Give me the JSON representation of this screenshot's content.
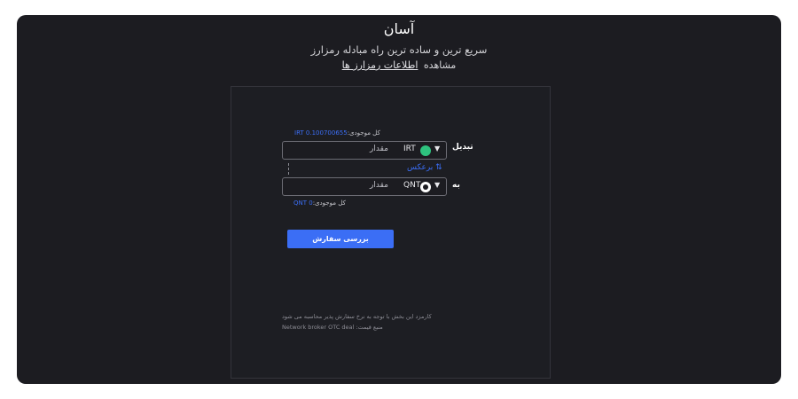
{
  "header": {
    "title": "آسان",
    "subtitle": "سریع ترین و ساده ترین راه مبادله رمزارز",
    "info_prefix": "مشاهده",
    "info_link": "اطلاعات رمزارز ها"
  },
  "from": {
    "label": "تبدیل",
    "balance_label": "کل موجودی:",
    "balance_value": "IRT 0.100700655",
    "currency": "IRT",
    "placeholder": "مقدار",
    "coin_icon_color": "#2ec27e"
  },
  "swap": {
    "label": "⇅ برعکس"
  },
  "to": {
    "label": "به",
    "balance_label": "کل موجودی:",
    "balance_value": "QNT 0",
    "currency": "QNT",
    "placeholder": "مقدار"
  },
  "submit": {
    "label": "بررسی سفارش"
  },
  "notes": {
    "fee": "کارمزد این بخش با توجه به نرخ سفارش پذیر محاسبه می شود",
    "source": "منبع قیمت: Network broker OTC deal"
  },
  "colors": {
    "accent": "#3b6ef5",
    "background": "#1c1c21"
  }
}
